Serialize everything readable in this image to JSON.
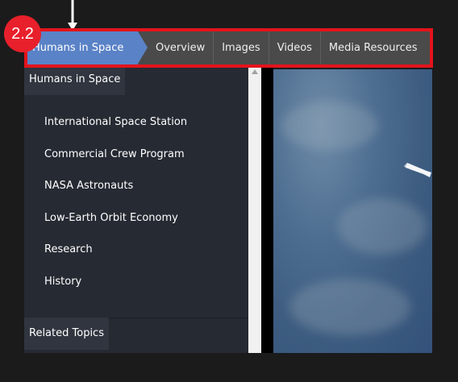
{
  "annotation": {
    "step_label": "2.2"
  },
  "tabbar": {
    "active_tab": "Humans in Space",
    "tabs": [
      "Overview",
      "Images",
      "Videos",
      "Media Resources"
    ]
  },
  "sidebar": {
    "header": "Humans in Space",
    "items": [
      "International Space Station",
      "Commercial Crew Program",
      "NASA Astronauts",
      "Low-Earth Orbit Economy",
      "Research",
      "History"
    ],
    "related_label": "Related Topics"
  },
  "colors": {
    "badge": "#e8202b",
    "highlight_border": "#e3141c",
    "active_tab": "#5a82c6",
    "tabbar": "#4a4a4a",
    "sidebar": "#262a33"
  },
  "icons": [
    "down-arrow-icon",
    "scroll-up-arrow-icon"
  ]
}
